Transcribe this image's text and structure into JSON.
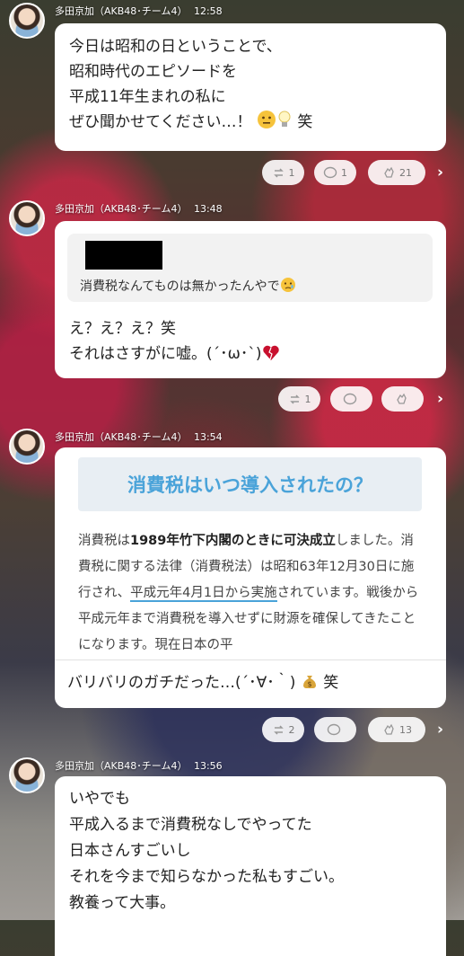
{
  "messages": [
    {
      "author": "多田京加（AKB48･チーム4）",
      "time": "12:58",
      "text": "今日は昭和の日ということで、\n昭和時代のエピソードを\n平成11年生まれの私に\nぜひ聞かせてください…！",
      "text_suffix": "笑",
      "reactions": {
        "repost": "1",
        "comment": "1",
        "clap": "21"
      }
    },
    {
      "author": "多田京加（AKB48･チーム4）",
      "time": "13:48",
      "quote": "消費税なんてものは無かったんやで",
      "text": "え？え？え？笑\nそれはさすがに嘘。(´･ω･`)",
      "reactions": {
        "repost": "1",
        "comment": "",
        "clap": ""
      }
    },
    {
      "author": "多田京加（AKB48･チーム4）",
      "time": "13:54",
      "article_title": "消費税はいつ導入されたの？",
      "article_body_1": "消費税は",
      "article_body_bold": "1989年竹下内閣のときに可決成立",
      "article_body_2": "しました。消費税に関する法律（消費税法）は昭和63年12月30日に施行され、",
      "article_body_underline": "平成元年4月1日から実施",
      "article_body_3": "されています。戦後から平成元年まで消費税を導入せずに財源を確保してきたことになります。現在日本の平",
      "text": "バリバリのガチだった…(´･∀･｀)",
      "text_suffix": "笑",
      "reactions": {
        "repost": "2",
        "comment": "",
        "clap": "13"
      }
    },
    {
      "author": "多田京加（AKB48･チーム4）",
      "time": "13:56",
      "text": "いやでも\n平成入るまで消費税なしでやってた\n日本さんすごいし\nそれを今まで知らなかった私もすごい。\n教養って大事。"
    }
  ]
}
